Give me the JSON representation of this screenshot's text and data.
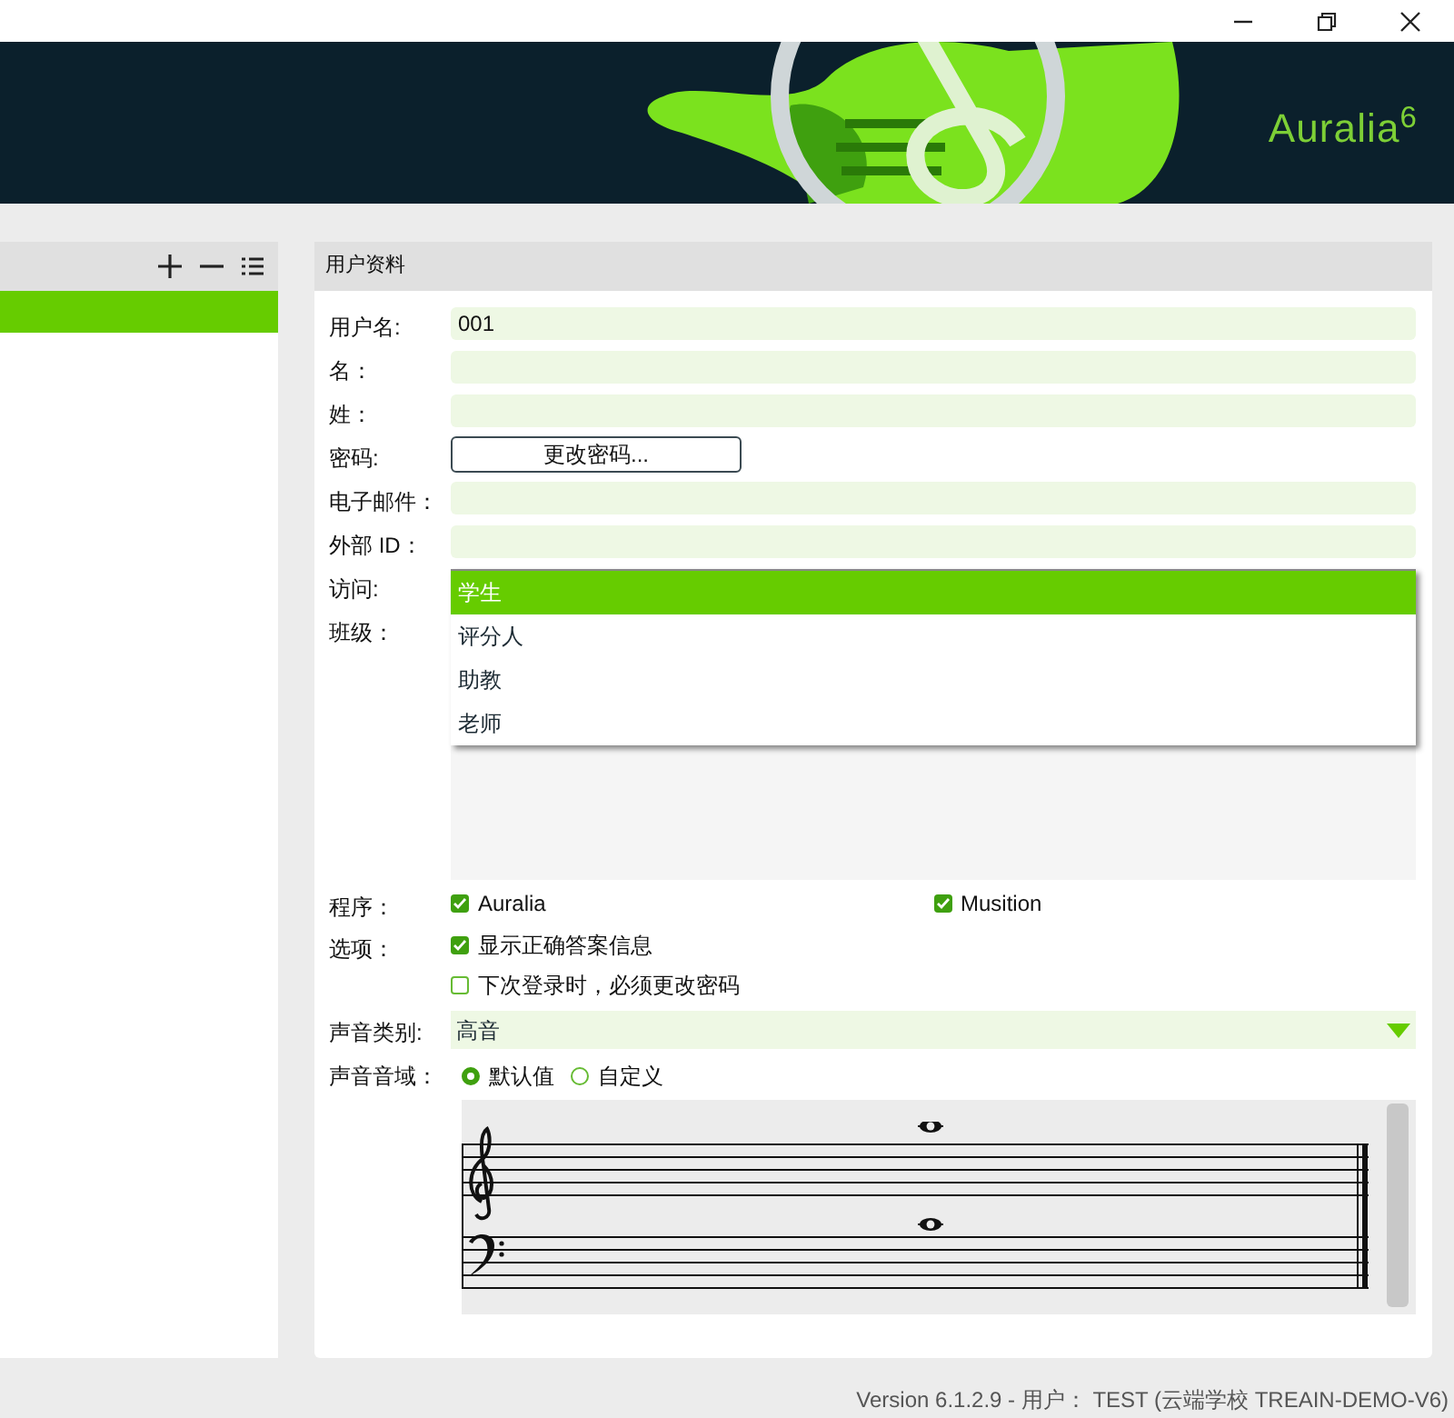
{
  "header": {
    "logo": "Auralia$^{6}$"
  },
  "left_panel": {
    "items": [
      {
        "selected": true
      }
    ]
  },
  "profile": {
    "title": "用户资料",
    "fields": [
      {
        "kind": "text",
        "label": "用户名:",
        "value": "001"
      },
      {
        "kind": "text",
        "label": "名："
      },
      {
        "kind": "text",
        "label": "姓："
      },
      {
        "kind": "button",
        "label": "密码:",
        "button": "更改密码..."
      },
      {
        "kind": "text",
        "label": "电子邮件："
      },
      {
        "kind": "text",
        "label": "外部 ID："
      }
    ],
    "access": {
      "label": "访问:",
      "options": [
        {
          "label": "学生",
          "selected": true
        },
        {
          "label": "评分人",
          "selected": false
        },
        {
          "label": "助教",
          "selected": false
        },
        {
          "label": "老师",
          "selected": false
        }
      ]
    },
    "class": {
      "label": "班级："
    },
    "programs": {
      "label": "程序：",
      "items": [
        {
          "label": "Auralia",
          "checked": true
        },
        {
          "label": "Musition",
          "checked": true
        }
      ]
    },
    "options": {
      "label": "选项：",
      "items": [
        {
          "label": "显示正确答案信息",
          "checked": true
        },
        {
          "label": "下次登录时，必须更改密码",
          "checked": false
        }
      ]
    },
    "voice_type": {
      "label": "声音类别:",
      "value": "高音"
    },
    "voice_range": {
      "label": "声音音域：",
      "options": [
        {
          "label": "默认值",
          "selected": true
        },
        {
          "label": "自定义",
          "selected": false
        }
      ]
    }
  },
  "status_bar": "Version 6.1.2.9 - 用户： TEST (云端学校 TREAIN-DEMO-V6)"
}
